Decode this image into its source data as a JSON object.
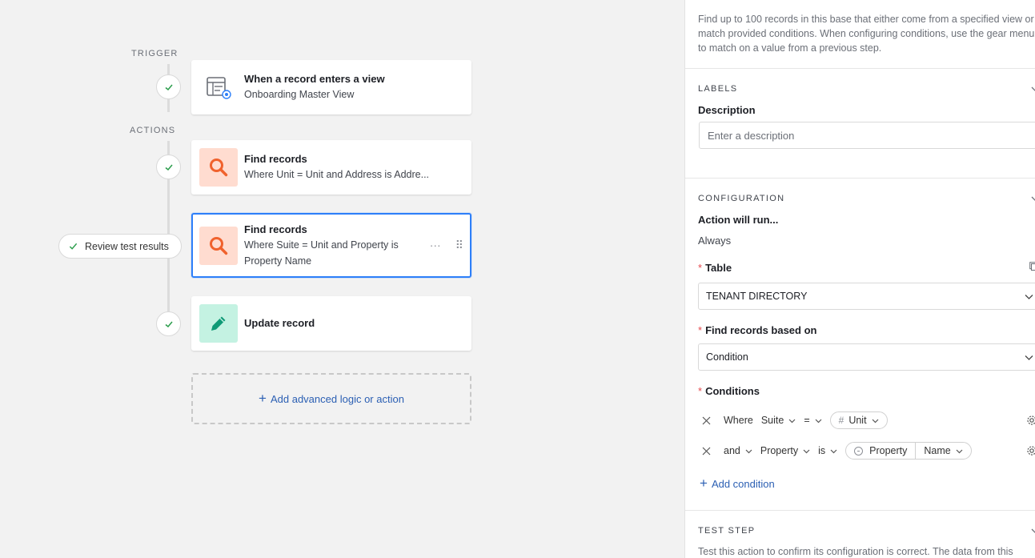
{
  "canvas": {
    "trigger_label": "TRIGGER",
    "actions_label": "ACTIONS",
    "trigger_card": {
      "title": "When a record enters a view",
      "subtitle": "Onboarding Master View",
      "icon": "table-view-icon"
    },
    "actions": [
      {
        "title": "Find records",
        "subtitle": "Where Unit = Unit and Address is Addre...",
        "icon": "search-icon",
        "color": "#ffdcd0"
      },
      {
        "title": "Find records",
        "subtitle": "Where Suite = Unit and Property is Property Name",
        "icon": "search-icon",
        "color": "#ffdcd0",
        "selected": true
      },
      {
        "title": "Update record",
        "subtitle": "",
        "icon": "pencil-icon",
        "color": "#c4f2e2"
      }
    ],
    "review_pill": "Review test results",
    "card_more": "···",
    "card_drag": "⠿",
    "add_action": "Add advanced logic or action"
  },
  "panel": {
    "intro": "Find up to 100 records in this base that either come from a specified view or match provided conditions. When configuring conditions, use the gear menu to match on a value from a previous step.",
    "labels_section": "LABELS",
    "description_label": "Description",
    "description_placeholder": "Enter a description",
    "config_section": "CONFIGURATION",
    "action_will_run_label": "Action will run...",
    "action_will_run_value": "Always",
    "table_label": "Table",
    "table_value": "TENANT DIRECTORY",
    "find_based_label": "Find records based on",
    "find_based_value": "Condition",
    "conditions_label": "Conditions",
    "conditions": [
      {
        "conjunction": "Where",
        "field": "Suite",
        "operator": "=",
        "value_parts": [
          "Unit"
        ],
        "value_icon": "hash-icon"
      },
      {
        "conjunction": "and",
        "field": "Property",
        "operator": "is",
        "value_parts": [
          "Property",
          "Name"
        ],
        "value_icon": "link-icon"
      }
    ],
    "add_condition": "Add condition",
    "test_section": "TEST STEP",
    "test_text": "Test this action to confirm its configuration is correct. The data from this",
    "required_mark": "*"
  },
  "colors": {
    "accent_blue": "#2d7ff9",
    "link_blue": "#2b5fb3",
    "check_green": "#2a9d4b",
    "search_orange": "#f0622d",
    "pencil_teal": "#0f9a76"
  }
}
